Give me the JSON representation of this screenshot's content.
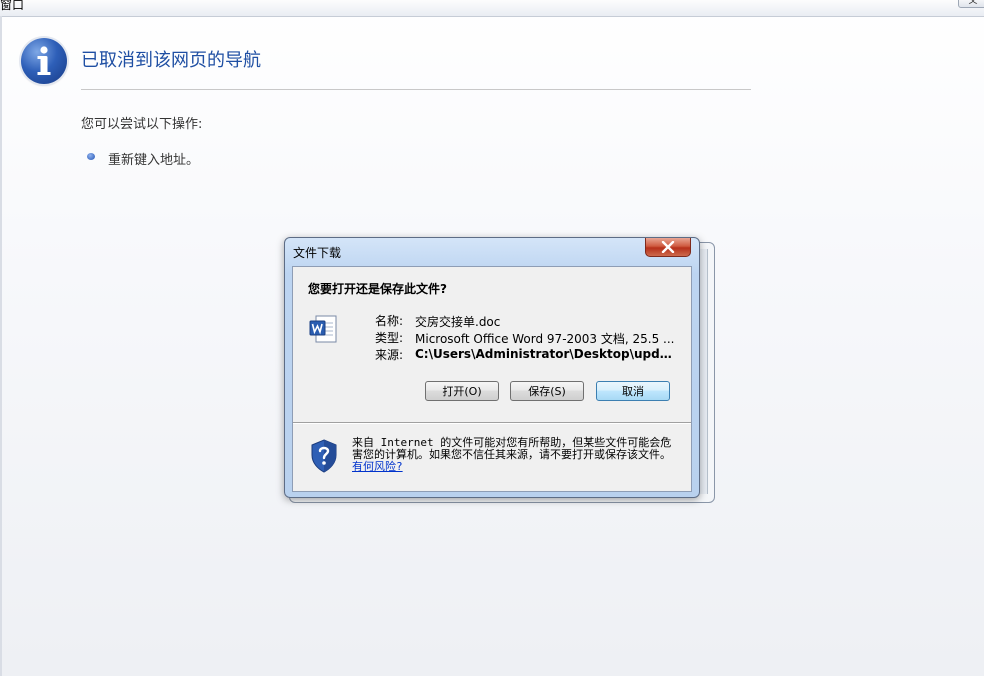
{
  "window": {
    "title_partial": "窗口",
    "right_button_partial": "文"
  },
  "page": {
    "title": "已取消到该网页的导航",
    "suggestion_intro": "您可以尝试以下操作:",
    "suggestions": [
      "重新键入地址。"
    ]
  },
  "dialog": {
    "title": "文件下载",
    "close_label": "x",
    "question": "您要打开还是保存此文件?",
    "fields": [
      {
        "label": "名称:",
        "value": "交房交接单.doc"
      },
      {
        "label": "类型:",
        "value": "Microsoft Office Word 97-2003 文档, 25.5 ..."
      },
      {
        "label": "来源:",
        "value": "C:\\Users\\Administrator\\Desktop\\update..."
      }
    ],
    "buttons": {
      "open": "打开(O)",
      "save": "保存(S)",
      "cancel": "取消"
    },
    "warning": {
      "text": "来自 Internet 的文件可能对您有所帮助，但某些文件可能会危害您的计算机。如果您不信任其来源，请不要打开或保存该文件。",
      "link": "有何风险?"
    }
  },
  "colors": {
    "title_blue": "#1f4fa3",
    "link_blue": "#0033cc",
    "close_red": "#c2432a",
    "dialog_frame": "#b9d1ee"
  },
  "icons": {
    "info": "info-icon",
    "bullet": "bullet-icon",
    "word": "word-document-icon",
    "shield": "security-shield-icon",
    "close": "close-icon"
  }
}
